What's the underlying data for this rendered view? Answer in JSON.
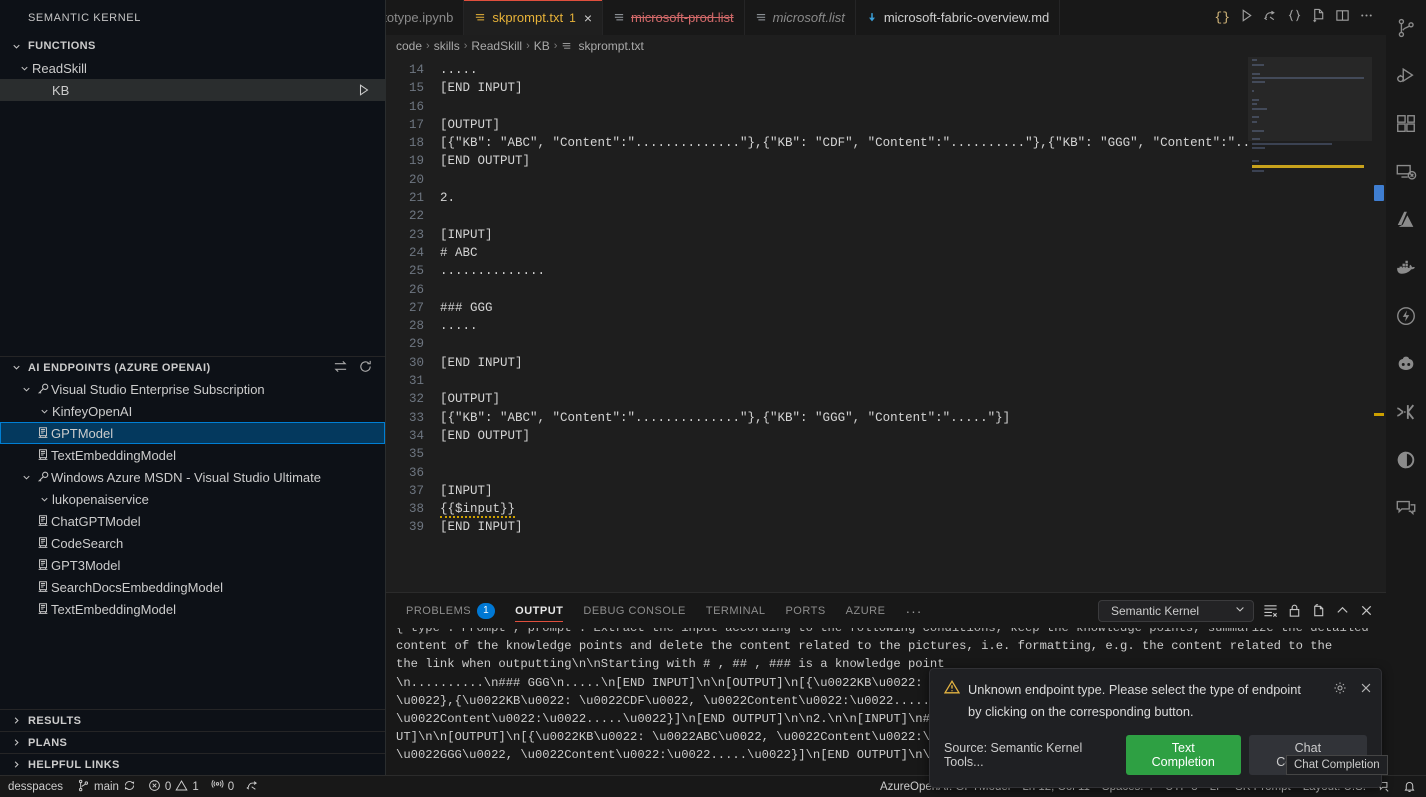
{
  "sidebar": {
    "title": "SEMANTIC KERNEL",
    "sections": {
      "functions": {
        "label": "FUNCTIONS",
        "items": [
          {
            "label": "ReadSkill",
            "indent": 16,
            "type": "folder",
            "expanded": true
          },
          {
            "label": "KB",
            "indent": 36,
            "type": "function",
            "run": "run-icon",
            "selected": false
          }
        ]
      },
      "ai_endpoints": {
        "label": "AI ENDPOINTS (AZURE OPENAI)",
        "actions": [
          "switch-icon",
          "refresh-icon"
        ],
        "items": [
          {
            "label": "Visual Studio Enterprise Subscription",
            "indent": 20,
            "type": "key",
            "expanded": true
          },
          {
            "label": "KinfeyOpenAI",
            "indent": 36,
            "type": "group",
            "expanded": true
          },
          {
            "label": "GPTModel",
            "indent": 34,
            "type": "model",
            "selected": true
          },
          {
            "label": "TextEmbeddingModel",
            "indent": 34,
            "type": "model"
          },
          {
            "label": "Windows Azure MSDN - Visual Studio Ultimate",
            "indent": 20,
            "type": "key",
            "expanded": true
          },
          {
            "label": "lukopenaiservice",
            "indent": 36,
            "type": "group",
            "expanded": true
          },
          {
            "label": "ChatGPTModel",
            "indent": 34,
            "type": "model"
          },
          {
            "label": "CodeSearch",
            "indent": 34,
            "type": "model"
          },
          {
            "label": "GPT3Model",
            "indent": 34,
            "type": "model"
          },
          {
            "label": "SearchDocsEmbeddingModel",
            "indent": 34,
            "type": "model"
          },
          {
            "label": "TextEmbeddingModel",
            "indent": 34,
            "type": "model"
          }
        ]
      },
      "results": {
        "label": "RESULTS"
      },
      "plans": {
        "label": "PLANS"
      },
      "helpful_links": {
        "label": "HELPFUL LINKS"
      }
    }
  },
  "tabs": [
    {
      "label": "ototype.ipynb",
      "state": "clipped",
      "icon": "",
      "italic": false
    },
    {
      "label": "skprompt.txt",
      "state": "active",
      "icon": "text-file-icon",
      "badge": "1",
      "close": "×"
    },
    {
      "label": "microsoft-prod.list",
      "state": "strikethrough",
      "icon": "text-file-icon"
    },
    {
      "label": "microsoft.list",
      "state": "italic",
      "icon": "text-file-icon"
    },
    {
      "label": "microsoft-fabric-overview.md",
      "state": "normal",
      "icon": "markdown-download-icon"
    }
  ],
  "tab_actions": [
    "json-braces-icon",
    "run-icon",
    "run-with-icon",
    "brackets-icon",
    "new-file-icon",
    "split-editor-icon",
    "more-actions-icon"
  ],
  "breadcrumb": [
    "code",
    "skills",
    "ReadSkill",
    "KB",
    "skprompt.txt"
  ],
  "editor": {
    "first_line_number": 14,
    "lines": [
      {
        "n": 14,
        "text": "....."
      },
      {
        "n": 15,
        "text": "[END INPUT]"
      },
      {
        "n": 16,
        "text": ""
      },
      {
        "n": 17,
        "text": "[OUTPUT]"
      },
      {
        "n": 18,
        "text": "[{\"KB\": \"ABC\", \"Content\":\"..............\"},{\"KB\": \"CDF\", \"Content\":\"..........\"},{\"KB\": \"GGG\", \"Content\":\"...."
      },
      {
        "n": 19,
        "text": "[END OUTPUT]"
      },
      {
        "n": 20,
        "text": ""
      },
      {
        "n": 21,
        "text": "2."
      },
      {
        "n": 22,
        "text": ""
      },
      {
        "n": 23,
        "text": "[INPUT]"
      },
      {
        "n": 24,
        "text": "# ABC"
      },
      {
        "n": 25,
        "text": ".............."
      },
      {
        "n": 26,
        "text": ""
      },
      {
        "n": 27,
        "text": "### GGG"
      },
      {
        "n": 28,
        "text": "....."
      },
      {
        "n": 29,
        "text": ""
      },
      {
        "n": 30,
        "text": "[END INPUT]"
      },
      {
        "n": 31,
        "text": ""
      },
      {
        "n": 32,
        "text": "[OUTPUT]"
      },
      {
        "n": 33,
        "text": "[{\"KB\": \"ABC\", \"Content\":\"..............\"},{\"KB\": \"GGG\", \"Content\":\".....\"}]"
      },
      {
        "n": 34,
        "text": "[END OUTPUT]"
      },
      {
        "n": 35,
        "text": ""
      },
      {
        "n": 36,
        "text": ""
      },
      {
        "n": 37,
        "text": "[INPUT]"
      },
      {
        "n": 38,
        "text": "{{$input}}",
        "squiggle": true
      },
      {
        "n": 39,
        "text": "[END INPUT]"
      }
    ]
  },
  "panel": {
    "tabs": [
      {
        "label": "PROBLEMS",
        "badge": "1",
        "active": false
      },
      {
        "label": "OUTPUT",
        "active": true
      },
      {
        "label": "DEBUG CONSOLE",
        "active": false
      },
      {
        "label": "TERMINAL",
        "active": false
      },
      {
        "label": "PORTS",
        "active": false
      },
      {
        "label": "AZURE",
        "active": false
      }
    ],
    "more": "···",
    "channel": "Semantic Kernel",
    "actions": [
      "clear-output-icon",
      "lock-icon",
      "open-in-editor-icon",
      "chevron-up-icon",
      "close-panel-icon"
    ],
    "output_lines": [
      "{ type : Prompt , prompt : Extract the input according to the following conditions, keep the knowledge points, summarize the detailed",
      "content of the knowledge points and delete the content related to the pictures, i.e. formatting, e.g. the content related to the",
      "the link when outputting\\n\\nStarting with # , ## , ### is a knowledge point",
      "\\n..........\\n### GGG\\n.....\\n[END INPUT]\\n\\n[OUTPUT]\\n[{\\u0022KB\\u0022:",
      "\\u0022},{\\u0022KB\\u0022: \\u0022CDF\\u0022, \\u0022Content\\u0022:\\u0022.....",
      "\\u0022Content\\u0022:\\u0022.....\\u0022}]\\n[END OUTPUT]\\n\\n2.\\n\\n[INPUT]\\n#",
      "UT]\\n\\n[OUTPUT]\\n[{\\u0022KB\\u0022: \\u0022ABC\\u0022, \\u0022Content\\u0022:\\",
      "\\u0022GGG\\u0022, \\u0022Content\\u0022:\\u0022.....\\u0022}]\\n[END OUTPUT]\\n\\n\\n[INPUT]\\n# What is Microsoft Fabric?  Microsoft Fabric is"
    ]
  },
  "notification": {
    "icon": "warning-icon",
    "message_line1": "Unknown endpoint type. Please select the type of endpoint",
    "message_line2": "by clicking on the corresponding button.",
    "gear": "gear-icon",
    "close": "close-icon",
    "source": "Source: Semantic Kernel Tools...",
    "primary_button": "Text Completion",
    "secondary_button": "Chat Completion",
    "tooltip": "Chat Completion",
    "primary_color": "#2ea043"
  },
  "activity_bar": [
    "source-control-icon",
    "run-and-debug-icon",
    "extensions-icon",
    "remote-explorer-icon",
    "azure-icon",
    "docker-icon",
    "azure-functions-icon",
    "github-copilot-icon",
    "semantic-kernel-icon",
    "pie-chart-icon",
    "chat-icon"
  ],
  "statusbar": {
    "remote": "desspaces",
    "branch": "main",
    "sync": "sync-icon",
    "errors": "0",
    "warnings": "1",
    "radio": "0",
    "ports_icon": "ports-icon",
    "right": [
      "AzureOpenAI: GPTModel",
      "Ln 12, Col 11",
      "Spaces: 4",
      "UTF-8",
      "LF",
      "SK Prompt",
      "Layout: U.S."
    ],
    "right_icons": [
      "feedback-icon",
      "bell-icon"
    ]
  }
}
